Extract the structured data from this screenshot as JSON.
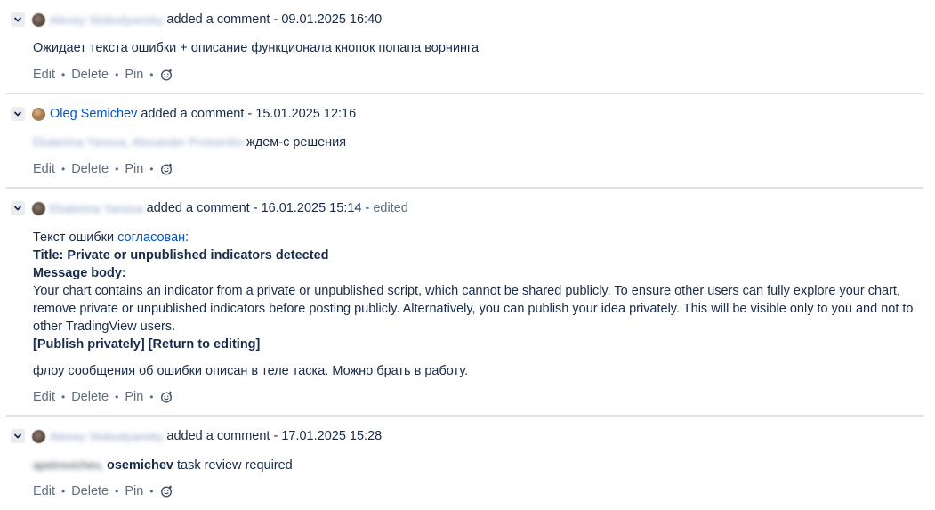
{
  "actions": {
    "edit": "Edit",
    "delete": "Delete",
    "pin": "Pin"
  },
  "comments": [
    {
      "author": "Alexey Slobodyansky",
      "meta": "added a comment - 09.01.2025 16:40",
      "text": "Ожидает текста ошибки + описание функционала кнопок попапа ворнинга"
    },
    {
      "author": "Oleg Semichev",
      "meta": "added a comment - 15.01.2025 12:16",
      "mentions": "Ekaterina Yanova, Alexander Protsenko",
      "text": "ждем-с решения"
    },
    {
      "author": "Ekaterina Yanova",
      "meta": "added a comment - 16.01.2025 15:14 -",
      "edited": "edited",
      "intro_prefix": "Текст ошибки",
      "intro_link": "согласован",
      "intro_suffix": ":",
      "title_line": "Title: Private or unpublished indicators detected",
      "body_heading": "Message body:",
      "message": "Your chart contains an indicator from a private or unpublished script, which cannot be shared publicly. To ensure other users can fully explore your chart, remove private or unpublished indicators before posting publicly. Alternatively, you can publish your idea privately. This will be visible only to you and not to other TradingView users.",
      "buttons_line": "[Publish privately] [Return to editing]",
      "followup": "флоу сообщения об ошибки описан в теле таска. Можно брать в работу."
    },
    {
      "author": "Alexey Slobodyansky",
      "meta": "added a comment - 17.01.2025 15:28",
      "mention_blurred": "apetrovichev,",
      "mention_user": "osemichev",
      "text": "task review required"
    }
  ],
  "colors": {
    "link": "#0052cc",
    "text": "#172b4d",
    "muted": "#5e6c84",
    "divider": "#dfe1e6"
  },
  "icons": {
    "toggle": "chevron-down-icon",
    "reaction": "add-reaction-icon"
  }
}
